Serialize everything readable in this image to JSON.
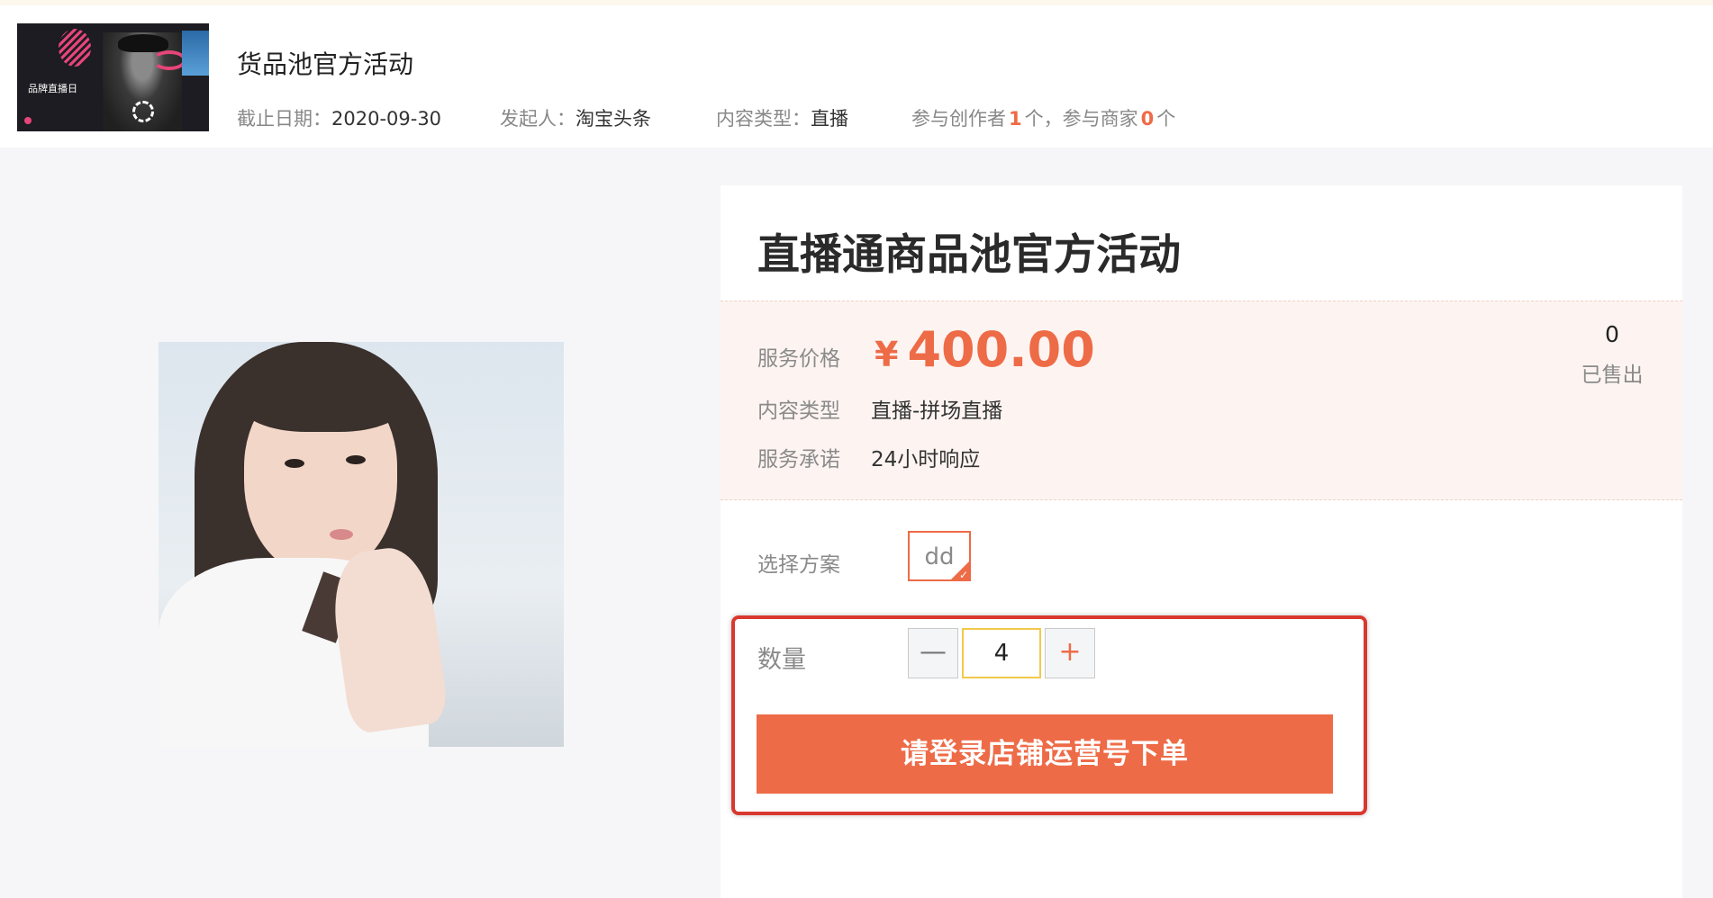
{
  "activity": {
    "banner_text": "品牌直播日",
    "title": "货品池官方活动",
    "deadline_label": "截止日期：",
    "deadline": "2020-09-30",
    "initiator_label": "发起人：",
    "initiator": "淘宝头条",
    "content_type_label": "内容类型：",
    "content_type": "直播",
    "creators_prefix": "参与创作者",
    "creators_count": "1",
    "creators_suffix": "个，参与商家",
    "merchants_count": "0",
    "merchants_suffix": "个"
  },
  "product": {
    "title": "直播通商品池官方活动",
    "price_label": "服务价格",
    "currency": "¥",
    "price": "400.00",
    "sold_count": "0",
    "sold_label": "已售出",
    "content_type_label": "内容类型",
    "content_type": "直播-拼场直播",
    "promise_label": "服务承诺",
    "promise": "24小时响应"
  },
  "purchase": {
    "plan_label": "选择方案",
    "plan_option": "dd",
    "quantity_label": "数量",
    "minus": "—",
    "plus": "+",
    "quantity": "4",
    "order_button": "请登录店铺运营号下单"
  },
  "colors": {
    "accent": "#ee6b47",
    "highlight_border": "#d9382f",
    "price_bg": "#fdf4f1"
  }
}
